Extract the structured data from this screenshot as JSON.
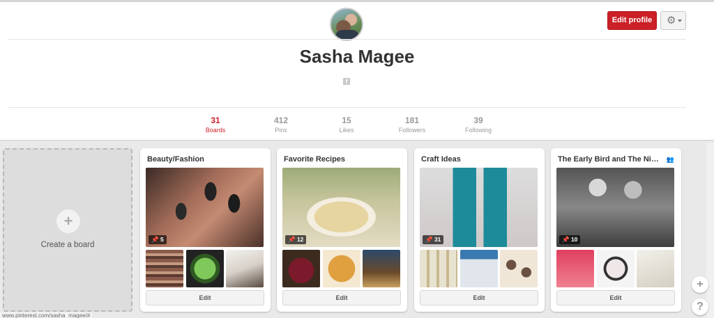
{
  "profile": {
    "name": "Sasha Magee",
    "facebook_icon": "f",
    "edit_profile_label": "Edit profile",
    "settings_icon": "gear-icon"
  },
  "stats": [
    {
      "value": "31",
      "label": "Boards",
      "active": true
    },
    {
      "value": "412",
      "label": "Pins"
    },
    {
      "value": "15",
      "label": "Likes"
    },
    {
      "value": "181",
      "label": "Followers"
    },
    {
      "value": "39",
      "label": "Following"
    }
  ],
  "create_board": {
    "icon": "+",
    "label": "Create a board"
  },
  "boards": [
    {
      "title": "Beauty/Fashion",
      "pins": "5",
      "edit": "Edit"
    },
    {
      "title": "Favorite Recipes",
      "pins": "12",
      "edit": "Edit"
    },
    {
      "title": "Craft Ideas",
      "pins": "31",
      "edit": "Edit"
    },
    {
      "title": "The Early Bird and The Night Owl",
      "pins": "10",
      "edit": "Edit",
      "group": true
    }
  ],
  "side_buttons": {
    "add": "+",
    "help": "?"
  },
  "status_url": "www.pinterest.com/sasha_magee/#",
  "colors": {
    "accent": "#cb2027",
    "muted": "#999999"
  }
}
